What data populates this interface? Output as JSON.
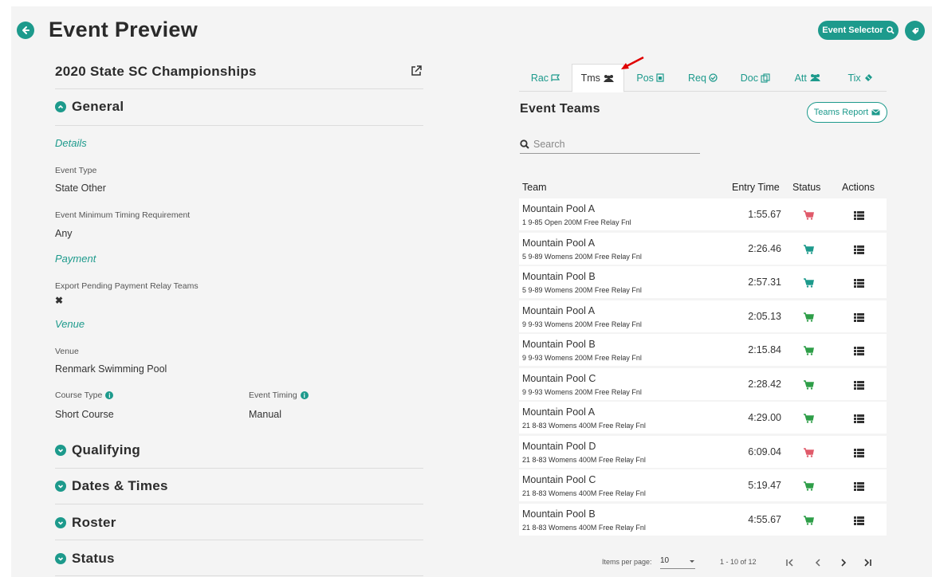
{
  "header": {
    "title": "Event Preview",
    "event_selector_label": "Event Selector"
  },
  "event": {
    "name": "2020 State SC Championships"
  },
  "sections": {
    "general": "General",
    "qualifying": "Qualifying",
    "dates_times": "Dates & Times",
    "roster": "Roster",
    "status": "Status"
  },
  "general": {
    "details_heading": "Details",
    "event_type_label": "Event Type",
    "event_type_value": "State Other",
    "min_timing_label": "Event Minimum Timing Requirement",
    "min_timing_value": "Any",
    "payment_heading": "Payment",
    "export_pending_label": "Export Pending Payment Relay Teams",
    "export_pending_value": "✖",
    "venue_heading": "Venue",
    "venue_label": "Venue",
    "venue_value": "Renmark Swimming Pool",
    "course_type_label": "Course Type",
    "course_type_value": "Short Course",
    "event_timing_label": "Event Timing",
    "event_timing_value": "Manual"
  },
  "tabs": [
    {
      "label": "Rac",
      "icon": "flag-icon"
    },
    {
      "label": "Tms",
      "icon": "users-icon"
    },
    {
      "label": "Pos",
      "icon": "clipboard-icon"
    },
    {
      "label": "Req",
      "icon": "check-circle-icon"
    },
    {
      "label": "Doc",
      "icon": "documents-icon"
    },
    {
      "label": "Att",
      "icon": "users-icon"
    },
    {
      "label": "Tix",
      "icon": "ticket-icon"
    }
  ],
  "teams_panel": {
    "title": "Event Teams",
    "report_button": "Teams Report",
    "search_placeholder": "Search",
    "columns": {
      "team": "Team",
      "entry_time": "Entry Time",
      "status": "Status",
      "actions": "Actions"
    },
    "rows": [
      {
        "team": "Mountain Pool A",
        "event": "1 9-85 Open 200M Free Relay Fnl",
        "time": "1:55.67",
        "status_color": "#e05a6a"
      },
      {
        "team": "Mountain Pool A",
        "event": "5 9-89 Womens 200M Free Relay Fnl",
        "time": "2:26.46",
        "status_color": "#1d9a8c"
      },
      {
        "team": "Mountain Pool B",
        "event": "5 9-89 Womens 200M Free Relay Fnl",
        "time": "2:57.31",
        "status_color": "#1d9a8c"
      },
      {
        "team": "Mountain Pool A",
        "event": "9 9-93 Womens 200M Free Relay Fnl",
        "time": "2:05.13",
        "status_color": "#2e9e48"
      },
      {
        "team": "Mountain Pool B",
        "event": "9 9-93 Womens 200M Free Relay Fnl",
        "time": "2:15.84",
        "status_color": "#2e9e48"
      },
      {
        "team": "Mountain Pool C",
        "event": "9 9-93 Womens 200M Free Relay Fnl",
        "time": "2:28.42",
        "status_color": "#2e9e48"
      },
      {
        "team": "Mountain Pool A",
        "event": "21 8-83 Womens 400M Free Relay Fnl",
        "time": "4:29.00",
        "status_color": "#2e9e48"
      },
      {
        "team": "Mountain Pool D",
        "event": "21 8-83 Womens 400M Free Relay Fnl",
        "time": "6:09.04",
        "status_color": "#e05a6a"
      },
      {
        "team": "Mountain Pool C",
        "event": "21 8-83 Womens 400M Free Relay Fnl",
        "time": "5:19.47",
        "status_color": "#2e9e48"
      },
      {
        "team": "Mountain Pool B",
        "event": "21 8-83 Womens 400M Free Relay Fnl",
        "time": "4:55.67",
        "status_color": "#2e9e48"
      }
    ],
    "pagination": {
      "items_per_page_label": "Items per page:",
      "items_per_page_value": "10",
      "range": "1 - 10 of 12"
    }
  },
  "colors": {
    "accent": "#1d9a8c",
    "status_red": "#e05a6a",
    "status_green": "#2e9e48"
  }
}
